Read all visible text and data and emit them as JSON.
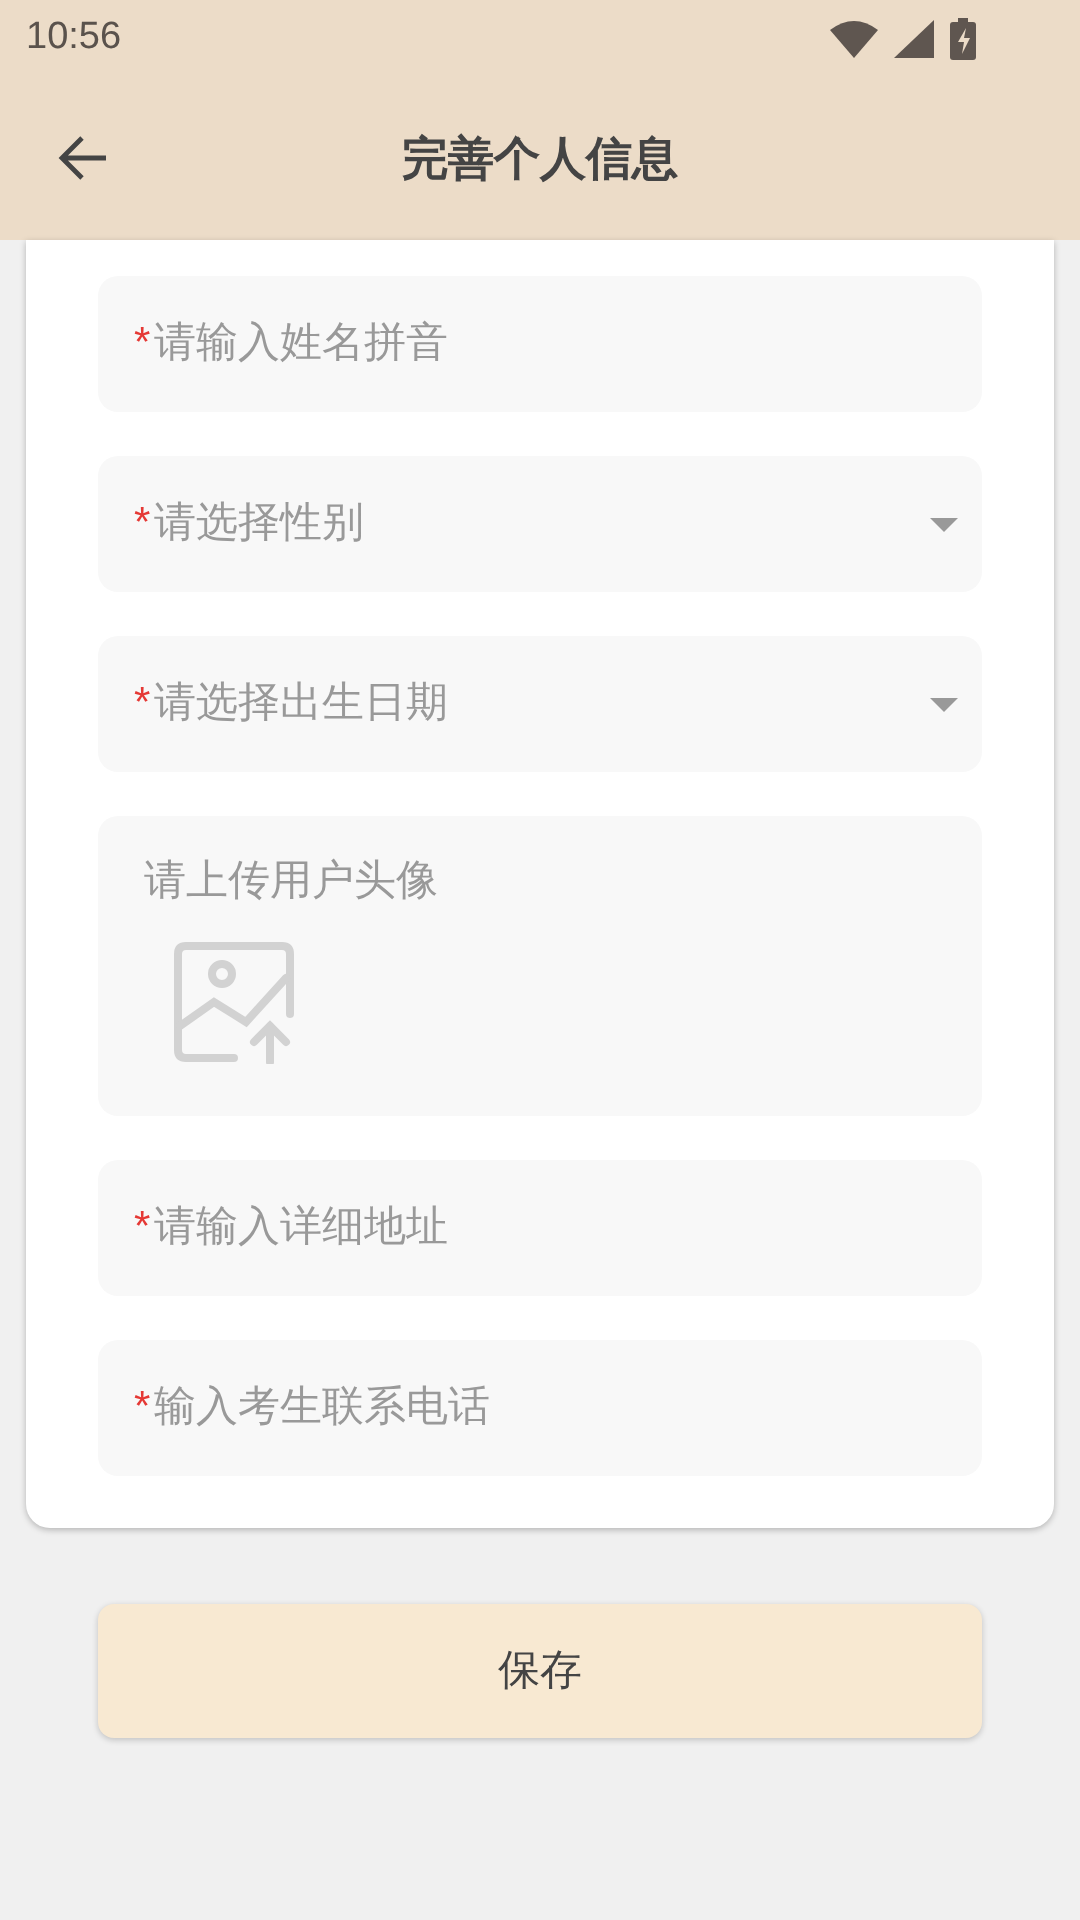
{
  "status_bar": {
    "time": "10:56"
  },
  "header": {
    "title": "完善个人信息"
  },
  "fields": [
    {
      "kind": "text",
      "mark": "*",
      "placeholder": "请输入姓名拼音"
    },
    {
      "kind": "select",
      "mark": "*",
      "placeholder": "请选择性别"
    },
    {
      "kind": "select",
      "mark": "*",
      "placeholder": "请选择出生日期"
    },
    {
      "kind": "upload",
      "label": "请上传用户头像"
    },
    {
      "kind": "text",
      "mark": "*",
      "placeholder": "请输入详细地址"
    },
    {
      "kind": "text",
      "mark": "*",
      "placeholder": "输入考生联系电话"
    }
  ],
  "save_button": {
    "label": "保存"
  }
}
